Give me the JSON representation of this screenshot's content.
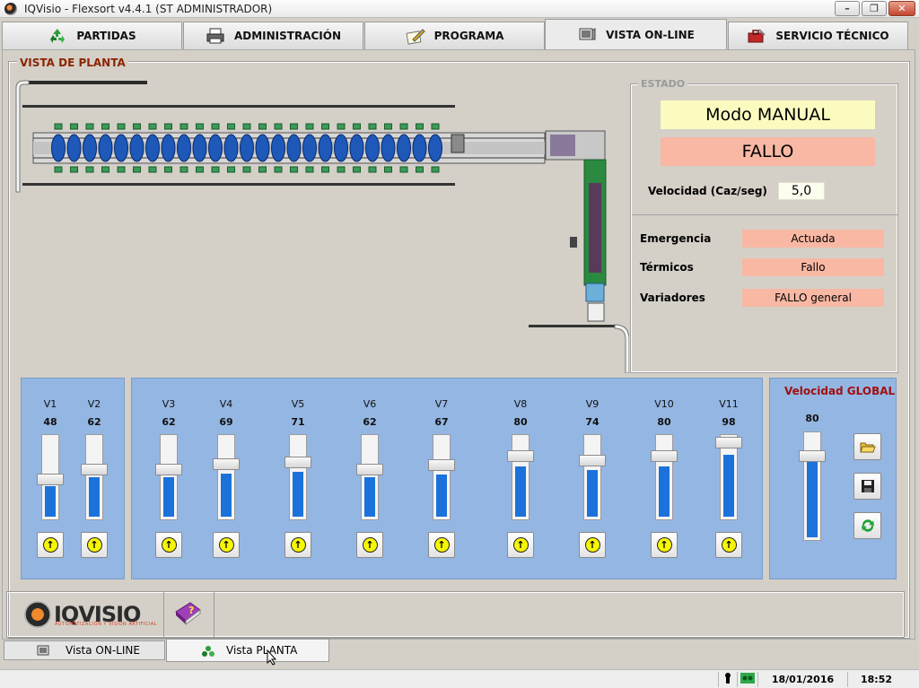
{
  "window": {
    "title": "IQVisio - Flexsort v4.4.1  (ST ADMINISTRADOR)",
    "minimize": "–",
    "maximize": "❐",
    "close": "✕"
  },
  "tabs": [
    {
      "label": "PARTIDAS",
      "icon": "recycle-icon"
    },
    {
      "label": "ADMINISTRACIÓN",
      "icon": "printer-icon"
    },
    {
      "label": "PROGRAMA",
      "icon": "pencil-paper-icon"
    },
    {
      "label": "VISTA ON-LINE",
      "icon": "monitor-icon",
      "active": true
    },
    {
      "label": "SERVICIO TÉCNICO",
      "icon": "toolbox-icon"
    }
  ],
  "plant": {
    "title": "VISTA DE PLANTA"
  },
  "estado": {
    "title": "ESTADO",
    "mode": "Modo MANUAL",
    "fault": "FALLO",
    "speed_label": "Velocidad (Caz/seg)",
    "speed_value": "5,0",
    "rows": [
      {
        "label": "Emergencia",
        "value": "Actuada"
      },
      {
        "label": "Térmicos",
        "value": "Fallo"
      },
      {
        "label": "Variadores",
        "value": "FALLO general"
      }
    ],
    "colors": {
      "mode_bg": "#fbfbc0",
      "fault_bg": "#f8b8a4"
    }
  },
  "valves": [
    {
      "name": "V1",
      "value": "48",
      "level": 48
    },
    {
      "name": "V2",
      "value": "62",
      "level": 62
    },
    {
      "name": "V3",
      "value": "62",
      "level": 62
    },
    {
      "name": "V4",
      "value": "69",
      "level": 69
    },
    {
      "name": "V5",
      "value": "71",
      "level": 71
    },
    {
      "name": "V6",
      "value": "62",
      "level": 62
    },
    {
      "name": "V7",
      "value": "67",
      "level": 67
    },
    {
      "name": "V8",
      "value": "80",
      "level": 80
    },
    {
      "name": "V9",
      "value": "74",
      "level": 74
    },
    {
      "name": "V10",
      "value": "80",
      "level": 80
    },
    {
      "name": "V11",
      "value": "98",
      "level": 98
    }
  ],
  "global": {
    "title": "Velocidad GLOBAL",
    "value": "80",
    "level": 80,
    "buttons": [
      "open-folder-icon",
      "save-icon",
      "refresh-icon"
    ]
  },
  "logo": {
    "text": "IQVISIO",
    "sub": "AUTOMATIZACIÓN Y VISIÓN ARTIFICIAL"
  },
  "subtabs": [
    {
      "label": "Vista ON-LINE"
    },
    {
      "label": "Vista PLANTA",
      "active": true
    }
  ],
  "status": {
    "date": "18/01/2016",
    "time": "18:52"
  },
  "colors": {
    "panel_bg": "#94b6e3",
    "slider_fill": "#1c72db",
    "accent_red": "#8b2500"
  }
}
